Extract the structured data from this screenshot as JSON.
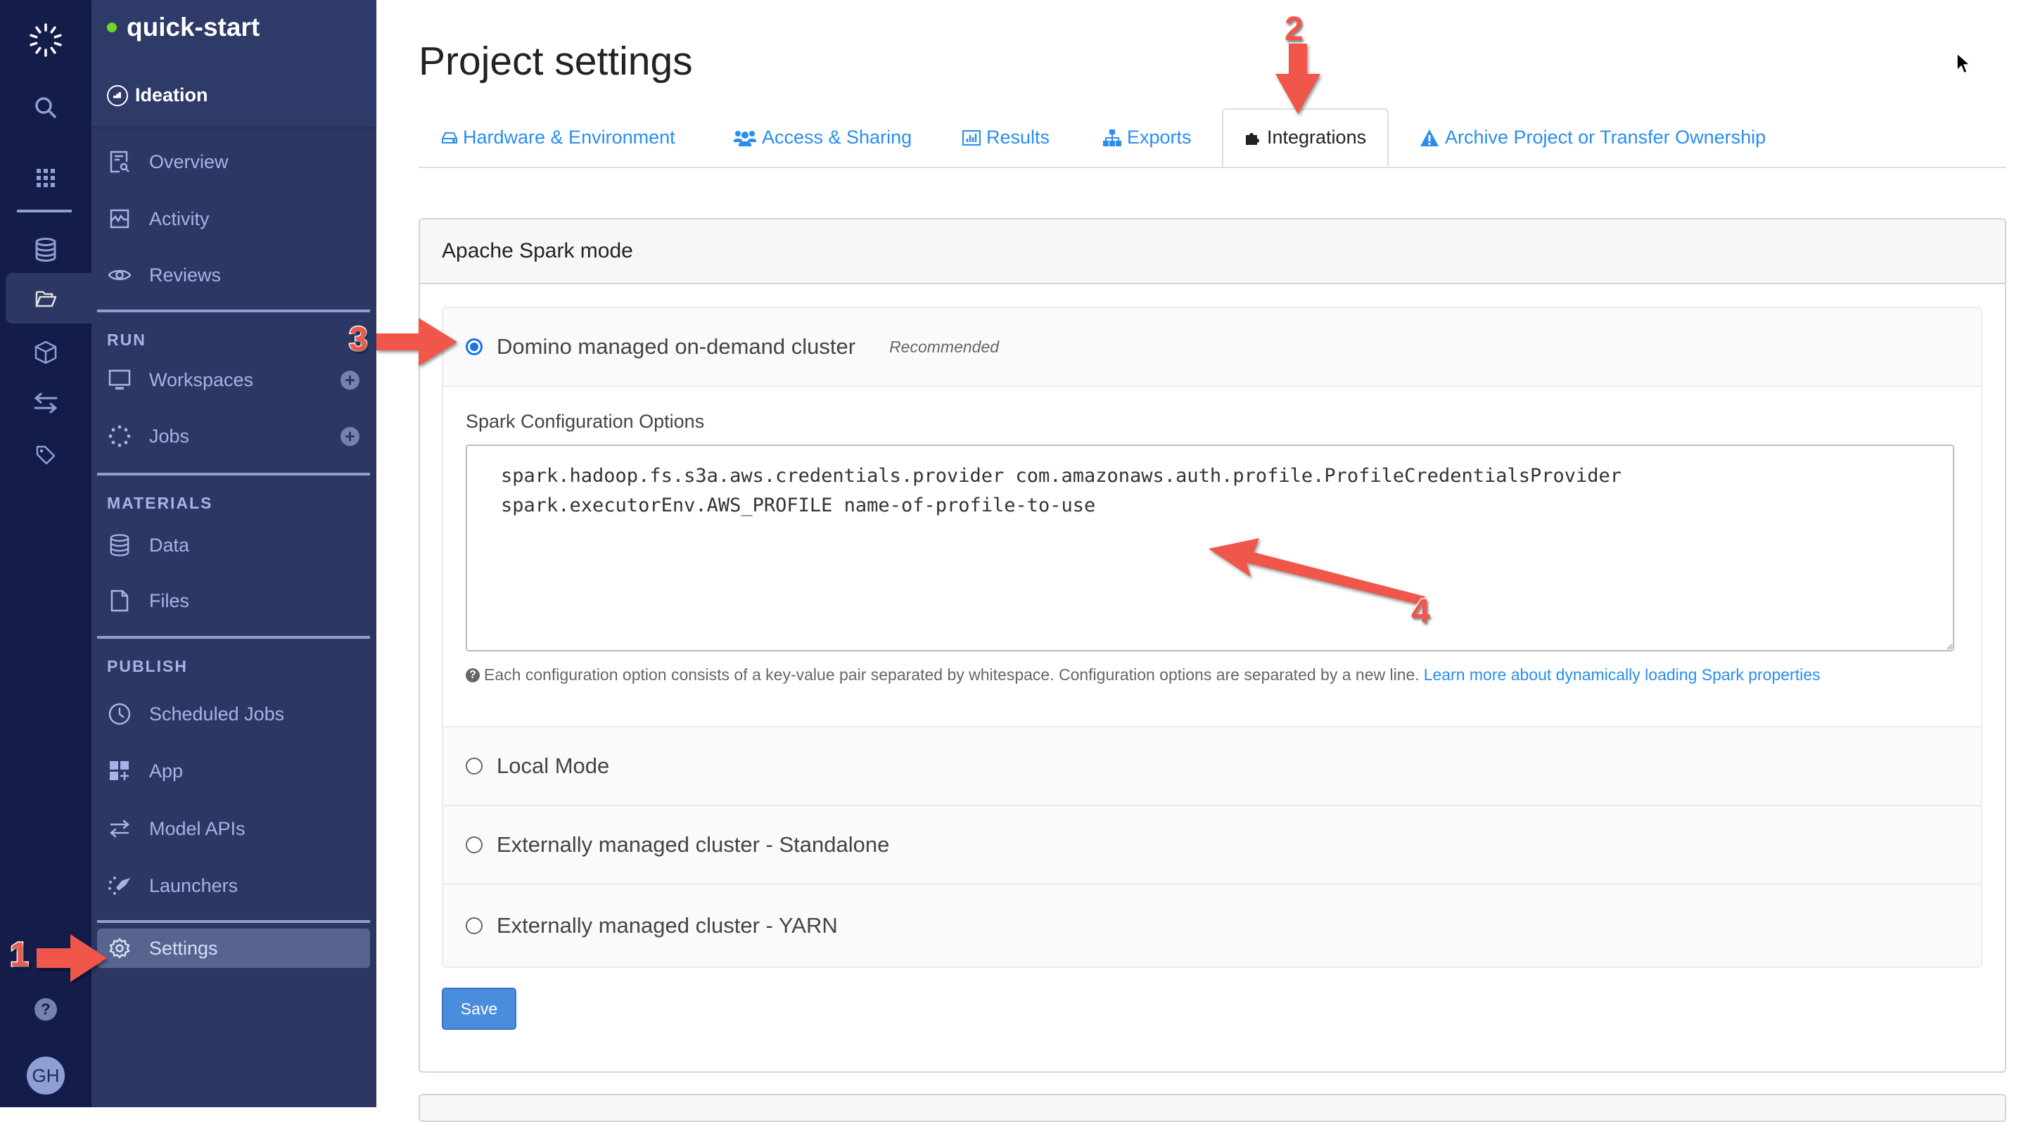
{
  "project": {
    "name": "quick-start",
    "status_color": "#6dd52d"
  },
  "stage": {
    "label": "Ideation"
  },
  "rail": {
    "icons": [
      "domino-logo-icon",
      "search-icon",
      "apps-grid-icon",
      "database-icon",
      "folder-open-icon",
      "cube-icon",
      "swap-arrows-icon",
      "tag-icon",
      "help-icon"
    ],
    "avatar_initials": "GH"
  },
  "nav": {
    "top_items": [
      {
        "label": "Overview",
        "icon": "overview-doc-icon"
      },
      {
        "label": "Activity",
        "icon": "activity-chart-icon"
      },
      {
        "label": "Reviews",
        "icon": "eye-icon"
      }
    ],
    "sections": [
      {
        "title": "RUN",
        "items": [
          {
            "label": "Workspaces",
            "icon": "monitor-icon",
            "add": "+"
          },
          {
            "label": "Jobs",
            "icon": "spinner-dots-icon",
            "add": "+"
          }
        ]
      },
      {
        "title": "MATERIALS",
        "items": [
          {
            "label": "Data",
            "icon": "database-icon"
          },
          {
            "label": "Files",
            "icon": "file-icon"
          }
        ]
      },
      {
        "title": "PUBLISH",
        "items": [
          {
            "label": "Scheduled Jobs",
            "icon": "clock-icon"
          },
          {
            "label": "App",
            "icon": "app-grid-plus-icon"
          },
          {
            "label": "Model APIs",
            "icon": "swap-arrows-icon"
          },
          {
            "label": "Launchers",
            "icon": "rocket-icon"
          }
        ]
      }
    ],
    "settings": {
      "label": "Settings",
      "icon": "gear-icon",
      "active": true
    }
  },
  "page": {
    "title": "Project settings"
  },
  "tabs": [
    {
      "label": "Hardware & Environment",
      "icon": "hdd-icon",
      "active": false
    },
    {
      "label": "Access & Sharing",
      "icon": "users-icon",
      "active": false
    },
    {
      "label": "Results",
      "icon": "bar-chart-icon",
      "active": false
    },
    {
      "label": "Exports",
      "icon": "sitemap-icon",
      "active": false
    },
    {
      "label": "Integrations",
      "icon": "puzzle-icon",
      "active": true
    },
    {
      "label": "Archive Project or Transfer Ownership",
      "icon": "warning-icon",
      "active": false
    }
  ],
  "spark": {
    "header": "Apache Spark mode",
    "options": [
      {
        "label": "Domino managed on-demand cluster",
        "badge": "Recommended",
        "selected": true
      },
      {
        "label": "Local Mode",
        "selected": false
      },
      {
        "label": "Externally managed cluster - Standalone",
        "selected": false
      },
      {
        "label": "Externally managed cluster - YARN",
        "selected": false
      }
    ],
    "config_label": "Spark Configuration Options",
    "config_value": "spark.hadoop.fs.s3a.aws.credentials.provider com.amazonaws.auth.profile.ProfileCredentialsProvider\nspark.executorEnv.AWS_PROFILE name-of-profile-to-use",
    "help_text": "Each configuration option consists of a key-value pair separated by whitespace. Configuration options are separated by a new line.",
    "help_link": "Learn more about dynamically loading Spark properties",
    "save_label": "Save"
  },
  "annotations": [
    "1",
    "2",
    "3",
    "4"
  ],
  "colors": {
    "link": "#2a8df0",
    "radio_selected": "#1a73e8",
    "save_button": "#4a8ddc",
    "annotation_arrow": "#f0564a",
    "rail_bg": "#141c4a",
    "nav_bg": "#2c3763"
  }
}
